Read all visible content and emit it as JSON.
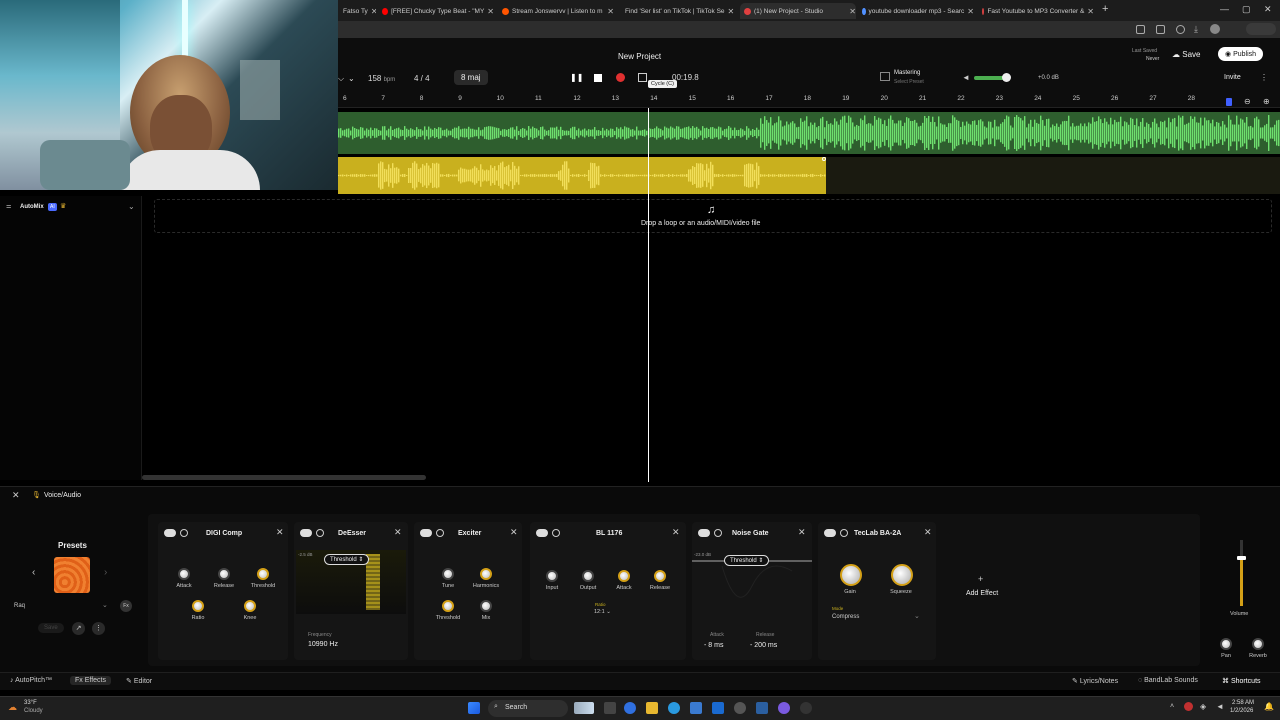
{
  "browser": {
    "tabs": [
      {
        "label": "Fatso Ty",
        "icon_color": "#e0a030"
      },
      {
        "label": "[FREE] Chucky Type Beat - \"MY",
        "icon_color": "#ff0000"
      },
      {
        "label": "Stream Jonswervv | Listen to m",
        "icon_color": "#ff5500"
      },
      {
        "label": "Find 'Ser list' on TikTok | TikTok Se",
        "icon_color": "#ffffff"
      },
      {
        "label": "(1) New Project - Studio",
        "icon_color": "#e04040"
      },
      {
        "label": "youtube downloader mp3 - Searc",
        "icon_color": "#5090ff"
      },
      {
        "label": "Fast Youtube to MP3 Converter &",
        "icon_color": "#d04040"
      }
    ],
    "new_tab": "+",
    "win_min": "—",
    "win_max": "▢",
    "win_close": "✕"
  },
  "header": {
    "project_title": "New Project",
    "bpm_value": "158",
    "bpm_unit": "bpm",
    "time_signature": "4 / 4",
    "key": "8 maj",
    "time_display": "00:19.8",
    "cycle_tooltip": "Cycle (C)",
    "mastering_title": "Mastering",
    "mastering_sub": "Select Preset",
    "volume_db": "+0.0 dB",
    "last_saved_label": "Last Saved",
    "last_saved_value": "Never",
    "save_label": "Save",
    "publish_label": "Publish",
    "invite_label": "Invite"
  },
  "ruler": {
    "ticks": [
      "6",
      "7",
      "8",
      "9",
      "10",
      "11",
      "12",
      "13",
      "14",
      "15",
      "16",
      "17",
      "18",
      "19",
      "20",
      "21",
      "22",
      "23",
      "24",
      "25",
      "26",
      "27",
      "28"
    ]
  },
  "tracks": {
    "automix_label": "AutoMix",
    "automix_badge": "AI",
    "drop_hint": "Drop a loop or an audio/MIDI/video file"
  },
  "fx": {
    "panel_title": "Voice/Audio",
    "presets_title": "Presets",
    "preset_name": "Raq",
    "save_label": "Save",
    "add_effect": "Add Effect",
    "volume_label": "Volume",
    "pan_label": "Pan",
    "reverb_label": "Reverb",
    "cards": {
      "digi": {
        "title": "DIGI Comp",
        "attack": "Attack",
        "release": "Release",
        "threshold": "Threshold",
        "ratio": "Ratio",
        "knee": "Knee"
      },
      "deesser": {
        "title": "DeEsser",
        "db": "-2.5 dB",
        "threshold": "Threshold",
        "frequency_label": "Frequency",
        "frequency_value": "10990 Hz"
      },
      "exciter": {
        "title": "Exciter",
        "tune": "Tune",
        "harmonics": "Harmonics",
        "threshold": "Threshold",
        "mix": "Mix"
      },
      "bl1176": {
        "title": "BL 1176",
        "input": "Input",
        "output": "Output",
        "attack": "Attack",
        "release": "Release",
        "ratio_label": "Ratio",
        "ratio_value": "12:1"
      },
      "noisegate": {
        "title": "Noise Gate",
        "db": "-23.0 dB",
        "threshold": "Threshold",
        "attack_label": "Attack",
        "attack_value": "8 ms",
        "release_label": "Release",
        "release_value": "200 ms"
      },
      "teclab": {
        "title": "TecLab BA-2A",
        "gain": "Gain",
        "squeeze": "Squeeze",
        "mode_label": "Mode",
        "mode_value": "Compress"
      }
    }
  },
  "bottom_bar": {
    "autopitch": "AutoPitch™",
    "effects": "Effects",
    "editor": "Editor",
    "lyrics": "Lyrics/Notes",
    "sounds": "BandLab Sounds",
    "shortcuts": "Shortcuts"
  },
  "taskbar": {
    "weather_temp": "33°F",
    "weather_desc": "Cloudy",
    "search": "Search",
    "time": "2:58 AM",
    "date": "1/2/2026"
  },
  "colors": {
    "track_green": "#4caf50",
    "track_yellow": "#c9b01e",
    "accent_knob": "#d4a017"
  }
}
